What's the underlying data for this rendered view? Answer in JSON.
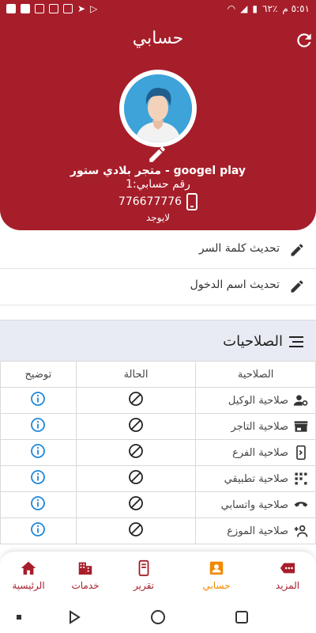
{
  "statusbar": {
    "time": "٥:٥١ م",
    "battery": "٪٦٢"
  },
  "appbar": {
    "title": "حسابي"
  },
  "profile": {
    "store_name": "googel play - متجر بلادي ستور",
    "account_number": "رقم حسابي:1",
    "phone": "776677776",
    "none_label": "لايوجد"
  },
  "actions": [
    {
      "label": "تحديث كلمة السر"
    },
    {
      "label": "تحديث اسم الدخول"
    }
  ],
  "permissions": {
    "title": "الصلاحيات",
    "columns": {
      "permission": "الصلاحية",
      "status": "الحالة",
      "description": "توضيح"
    },
    "rows": [
      {
        "name": "صلاحية الوكيل",
        "icon": "user-gear-icon"
      },
      {
        "name": "صلاحية التاجر",
        "icon": "store-icon"
      },
      {
        "name": "صلاحية الفرع",
        "icon": "mobile-icon"
      },
      {
        "name": "صلاحية تطبيقي",
        "icon": "grid-pattern-icon"
      },
      {
        "name": "صلاحية واتسابي",
        "icon": "phone-handset-icon"
      },
      {
        "name": "صلاحية الموزع",
        "icon": "people-add-icon"
      }
    ]
  },
  "bottomnav": [
    {
      "label": "المزيد",
      "icon": "more-tag-icon"
    },
    {
      "label": "حسابي",
      "icon": "account-card-icon"
    },
    {
      "label": "تقرير",
      "icon": "report-phone-icon"
    },
    {
      "label": "خدمات",
      "icon": "building-icon"
    },
    {
      "label": "الرئيسية",
      "icon": "home-icon"
    }
  ],
  "colors": {
    "primary": "#a61e2a",
    "active": "#f08a00",
    "info": "#1e88d8"
  }
}
